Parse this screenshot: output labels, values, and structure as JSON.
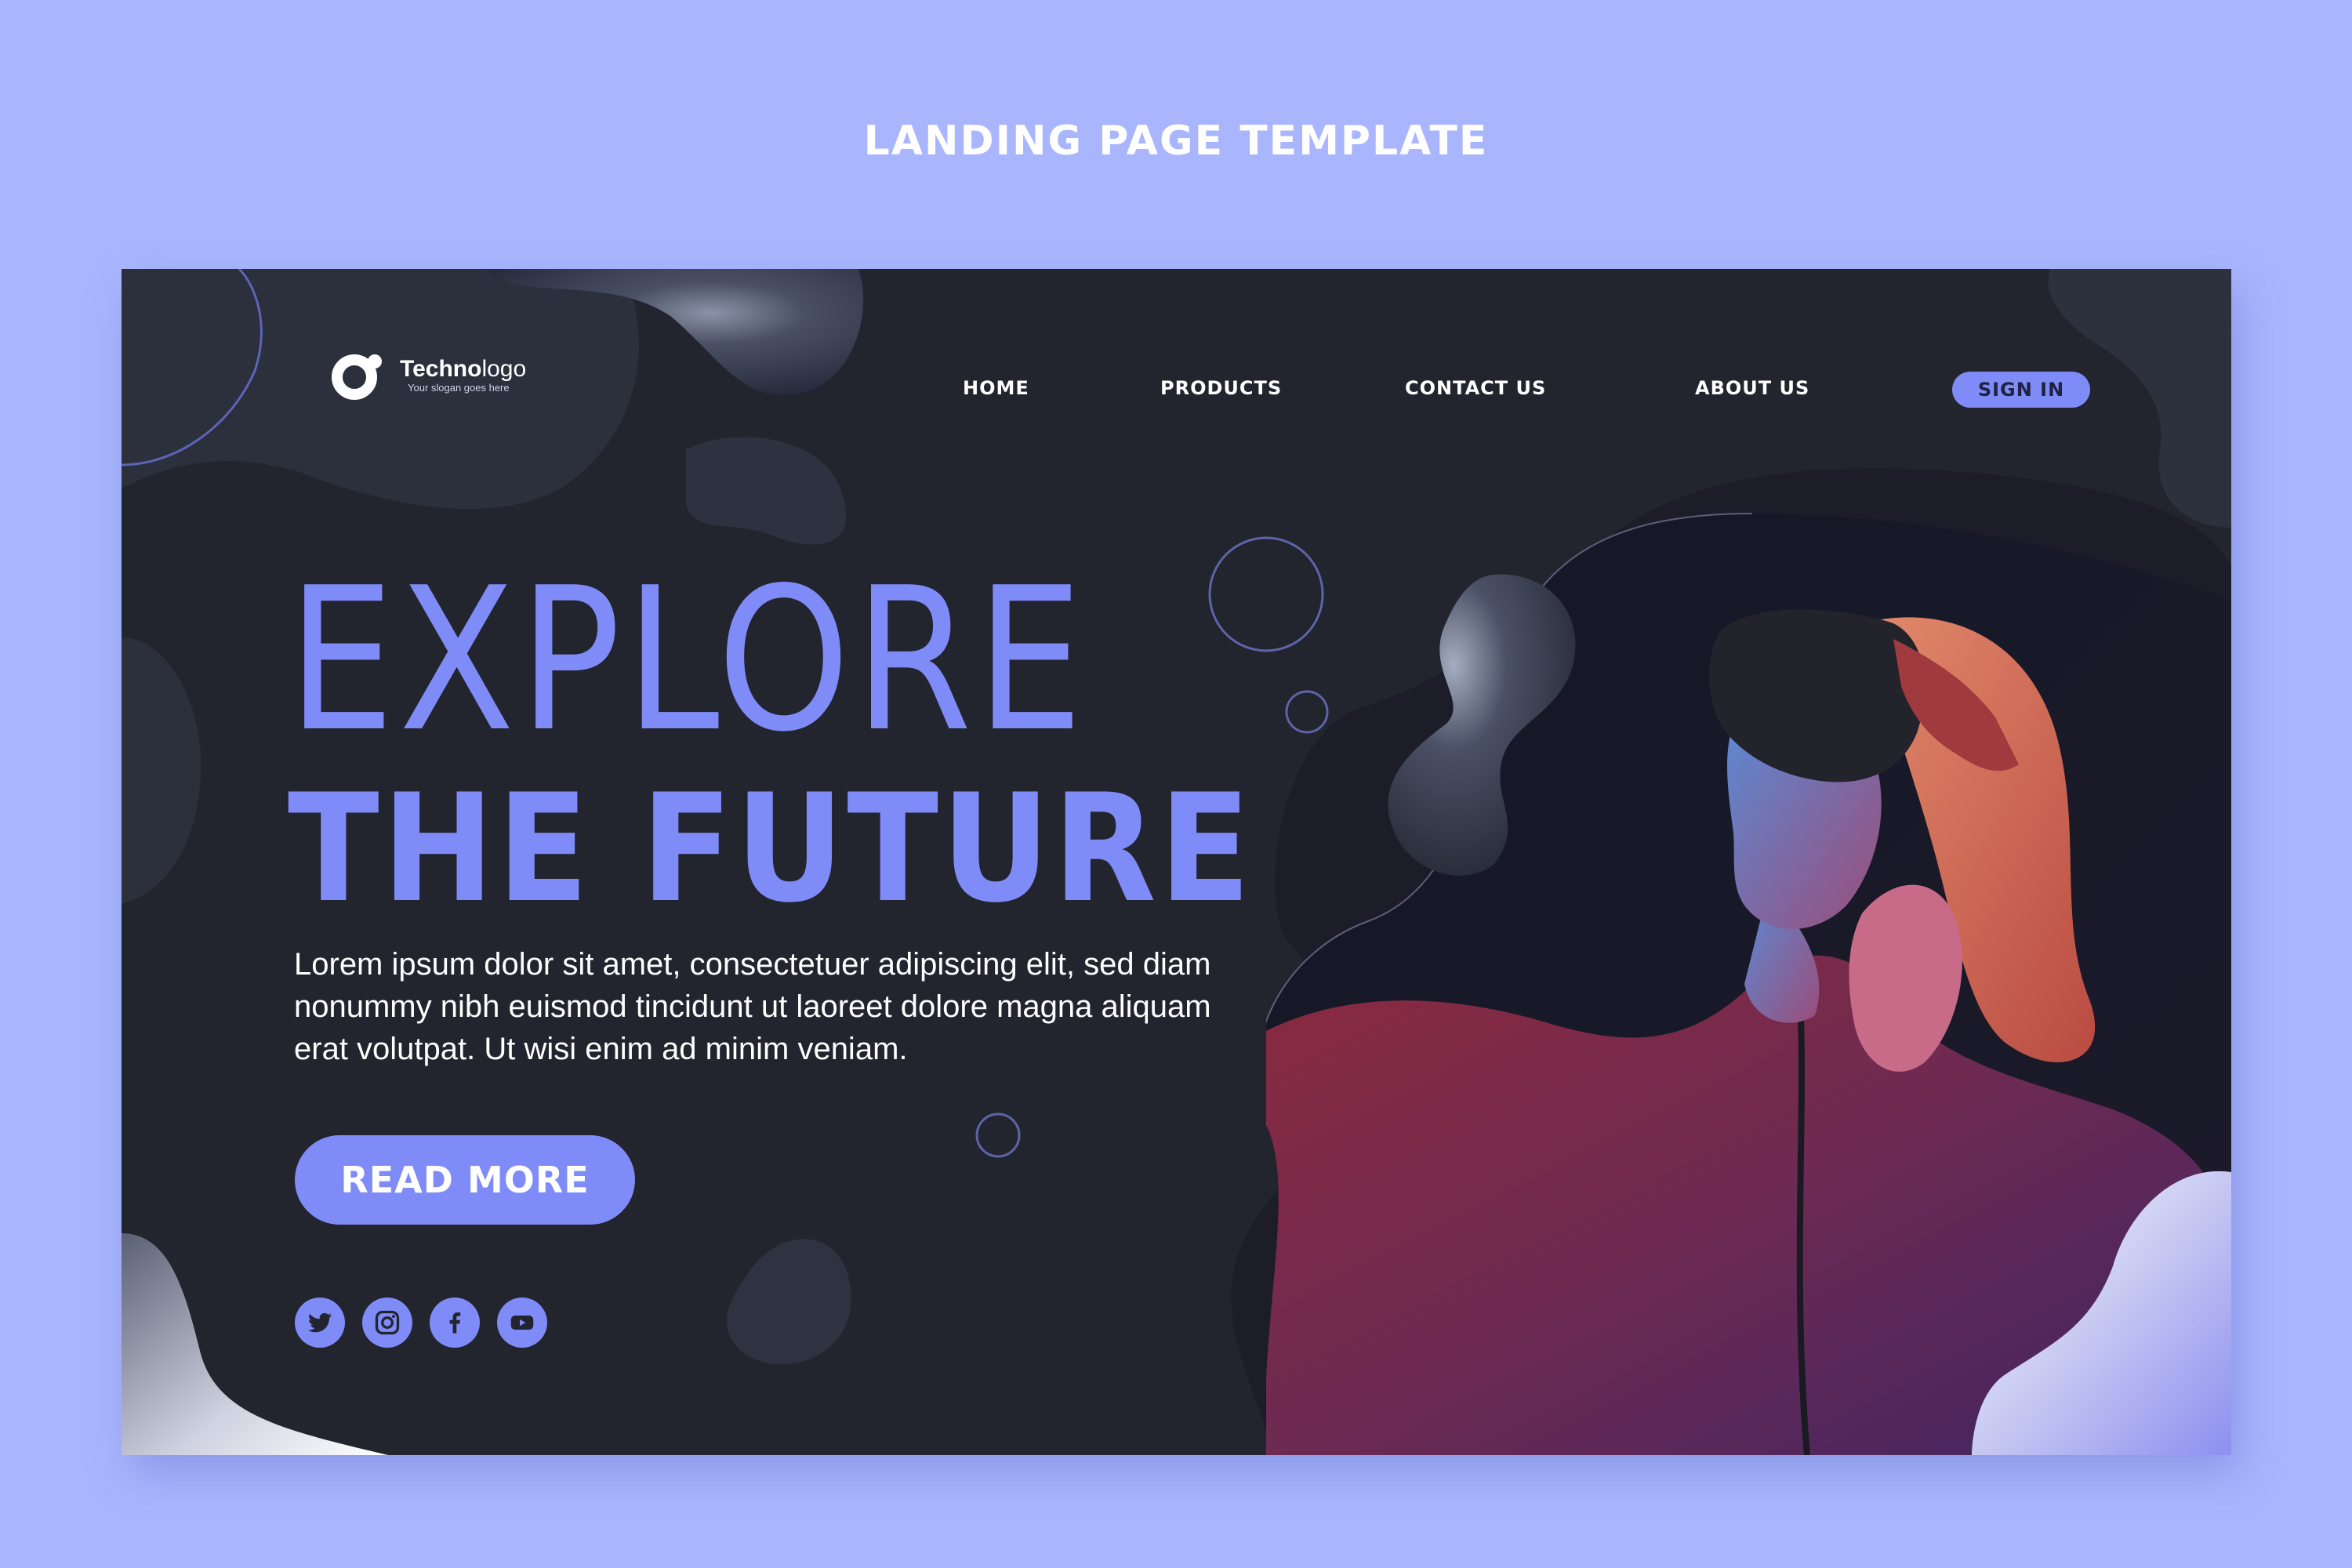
{
  "page_heading": "LANDING PAGE TEMPLATE",
  "logo": {
    "name_bold": "Techno",
    "name_light": "logo",
    "slogan": "Your slogan goes here",
    "icon": "logo-ring-icon"
  },
  "nav": {
    "items": [
      {
        "label": "HOME"
      },
      {
        "label": "PRODUCTS"
      },
      {
        "label": "CONTACT US"
      },
      {
        "label": "ABOUT US"
      }
    ],
    "signin_label": "SIGN IN"
  },
  "hero": {
    "line1": "EXPLORE",
    "line2": "THE FUTURE",
    "body": "Lorem ipsum dolor sit amet, consectetuer adipiscing elit, sed diam nonummy nibh euismod tincidunt ut laoreet dolore magna aliquam erat volutpat. Ut wisi enim ad minim veniam.",
    "cta_label": "READ MORE",
    "photo_icon": "vr-headset-photo"
  },
  "socials": [
    {
      "icon": "twitter-icon"
    },
    {
      "icon": "instagram-icon"
    },
    {
      "icon": "facebook-icon"
    },
    {
      "icon": "youtube-icon"
    }
  ],
  "colors": {
    "page_bg": "#a9b6fd",
    "card_bg": "#22242e",
    "accent": "#7f8cf8",
    "text": "#ffffff"
  }
}
